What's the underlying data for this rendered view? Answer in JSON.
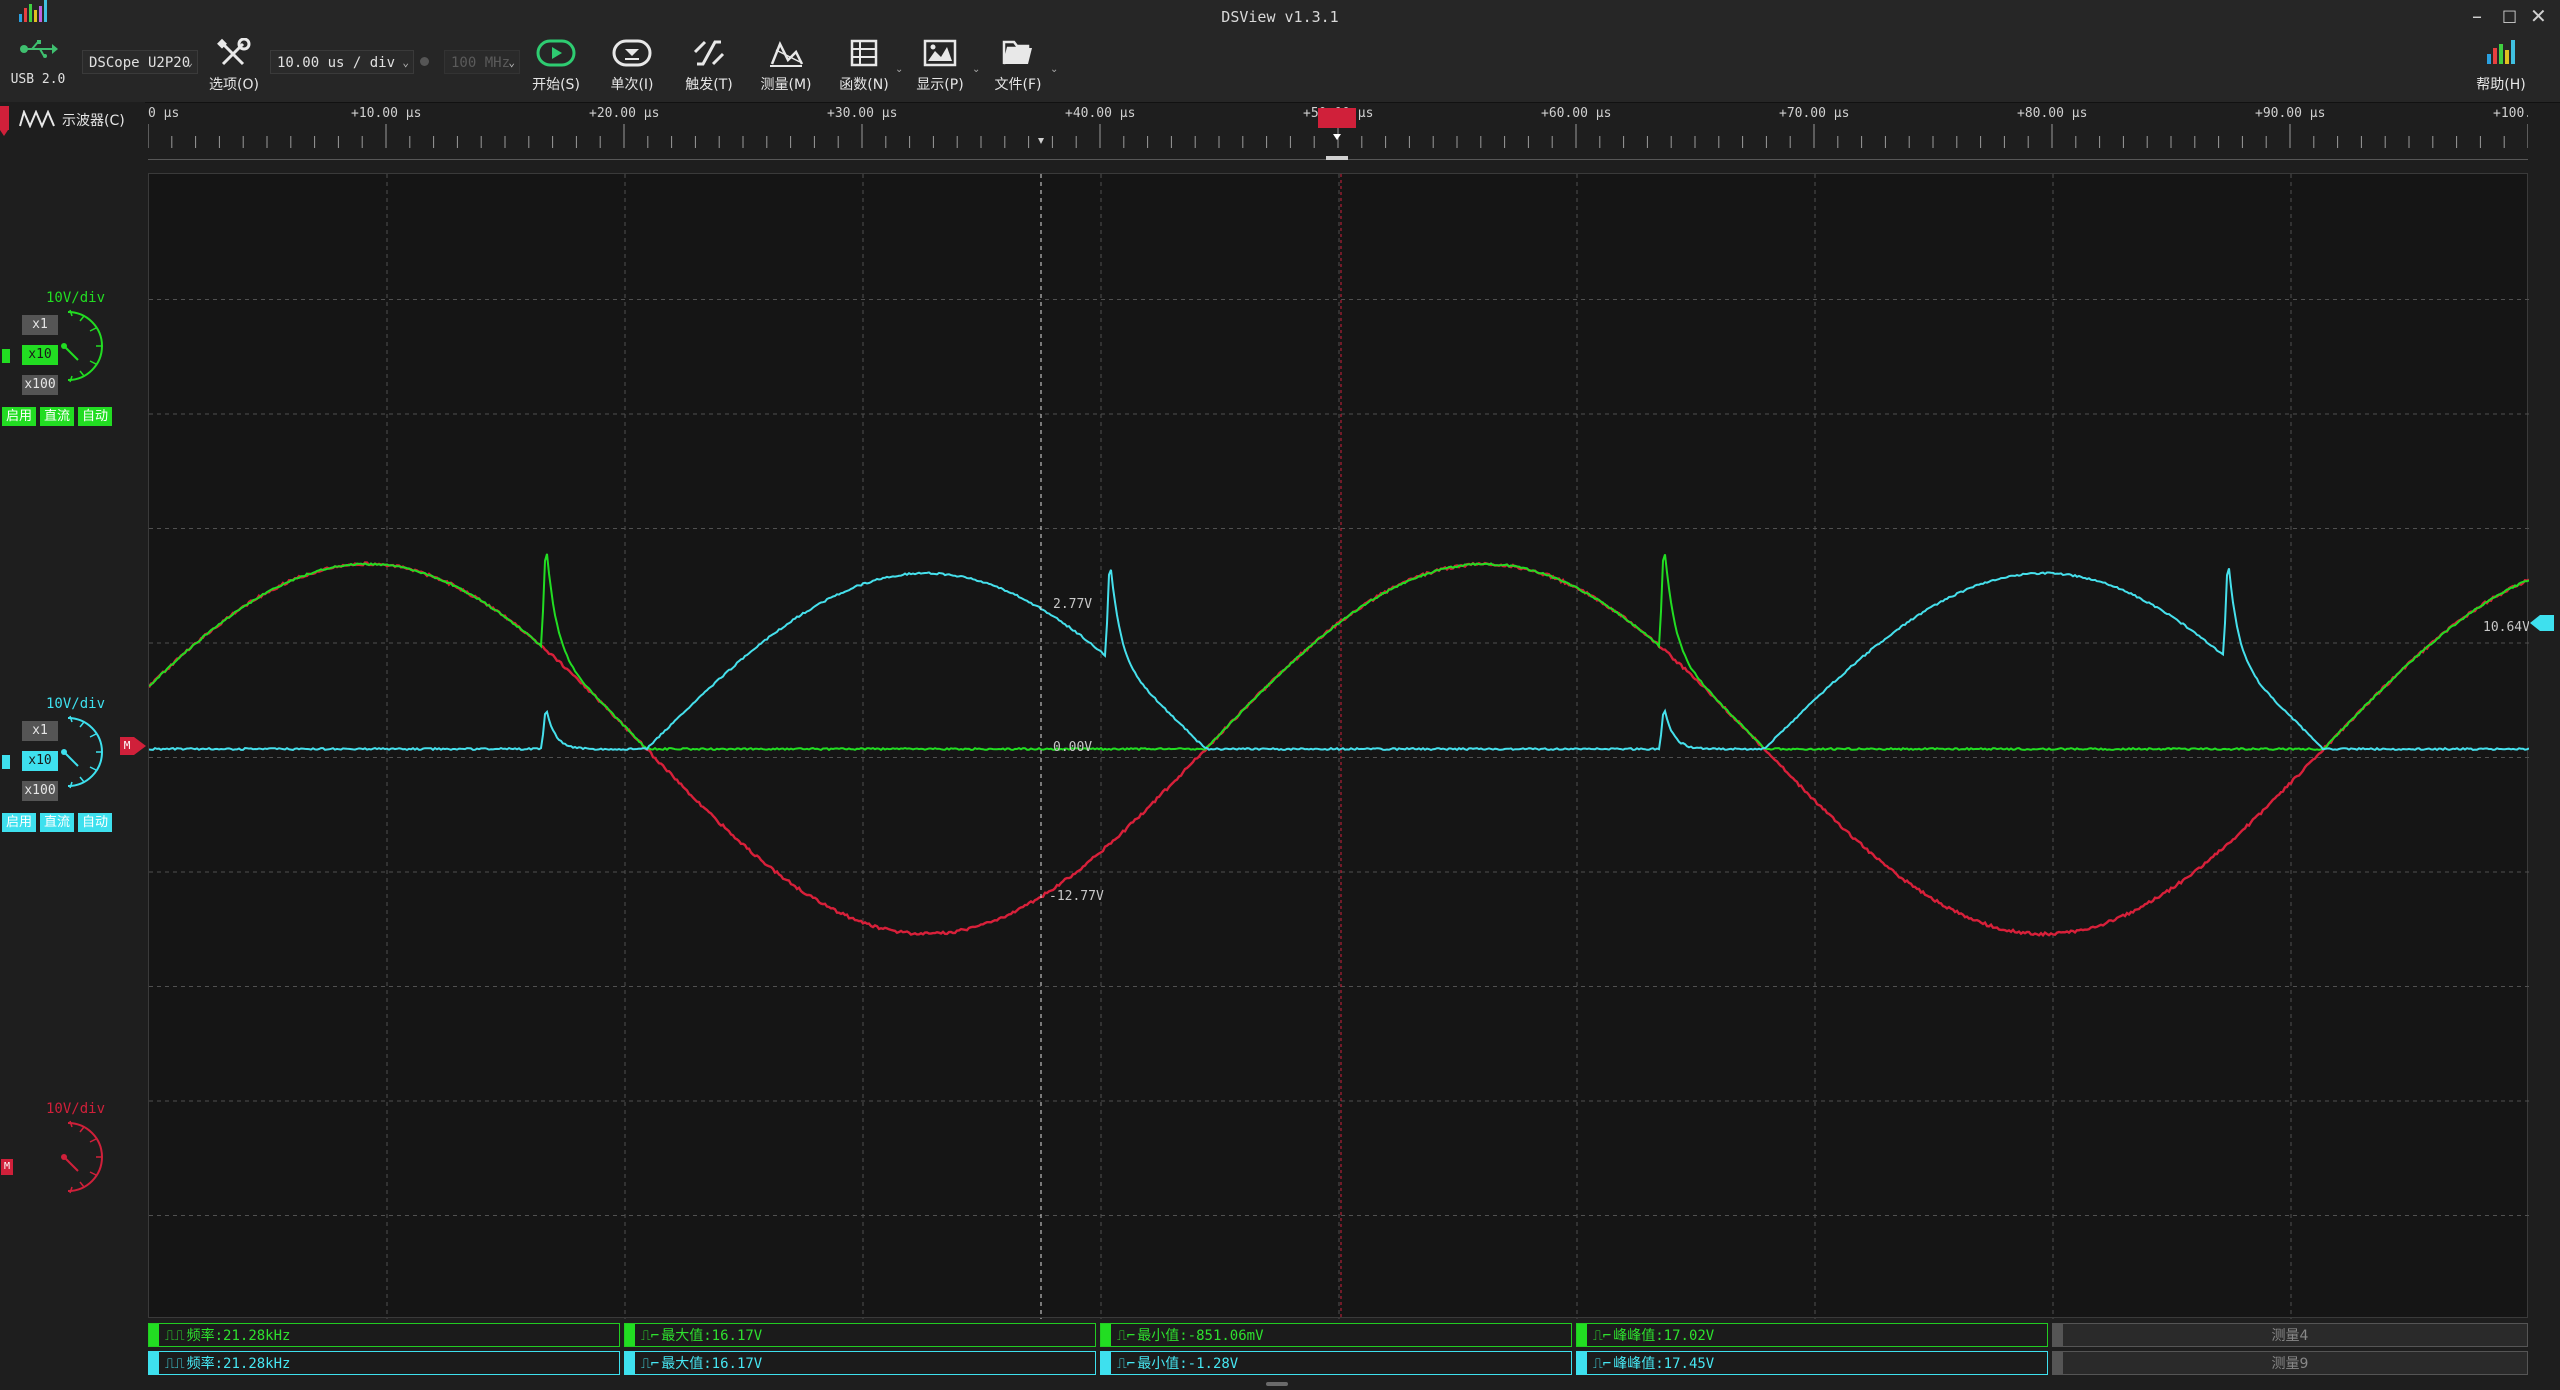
{
  "app": {
    "title": "DSView v1.3.1",
    "usb": "USB 2.0"
  },
  "toolbar": {
    "device": "DSCope U2P20",
    "timebase": "10.00 us / div",
    "bandwidth": "100 MHz",
    "buttons": [
      {
        "label": "选项(O)",
        "icon": "wrench-screwdriver-icon"
      },
      {
        "label": "开始(S)",
        "icon": "play-icon"
      },
      {
        "label": "单次(I)",
        "icon": "single-shot-icon"
      },
      {
        "label": "触发(T)",
        "icon": "trigger-icon"
      },
      {
        "label": "测量(M)",
        "icon": "measure-icon"
      },
      {
        "label": "函数(N)",
        "icon": "function-icon"
      },
      {
        "label": "显示(P)",
        "icon": "display-icon"
      },
      {
        "label": "文件(F)",
        "icon": "folder-icon"
      }
    ],
    "help": "帮助(H)"
  },
  "mode": {
    "label": "示波器(C)"
  },
  "channels": [
    {
      "id": "ch0",
      "color": "#22dd22",
      "vdiv": "10V/div",
      "scales": [
        "x1",
        "x10",
        "x100"
      ],
      "selected_scale": "x10",
      "buttons": [
        "启用",
        "直流",
        "自动"
      ]
    },
    {
      "id": "ch1",
      "color": "#3ee0ee",
      "vdiv": "10V/div",
      "scales": [
        "x1",
        "x10",
        "x100"
      ],
      "selected_scale": "x10",
      "buttons": [
        "启用",
        "直流",
        "自动"
      ]
    },
    {
      "id": "math",
      "color": "#d0203a",
      "vdiv": "10V/div",
      "marker": "M"
    }
  ],
  "ruler": {
    "labels": [
      "0 μs",
      "+10.00 μs",
      "+20.00 μs",
      "+30.00 μs",
      "+40.00 μs",
      "+50.00 μs",
      "+60.00 μs",
      "+70.00 μs",
      "+80.00 μs",
      "+90.00 μs",
      "+100."
    ]
  },
  "plot": {
    "cursor_labels": [
      "2.77V",
      "0.00V",
      "-12.77V"
    ],
    "right_marker": "10.64V",
    "math_marker": "M",
    "colors": {
      "ch0": "#22dd22",
      "ch1": "#46e0ec",
      "math": "#d8203a",
      "trigger": "#d0203a",
      "grid": "#505050"
    }
  },
  "measurements": {
    "row0": [
      "频率:21.28kHz",
      "最大值:16.17V",
      "最小值:-851.06mV",
      "峰峰值:17.02V",
      "测量4"
    ],
    "row1": [
      "频率:21.28kHz",
      "最大值:16.17V",
      "最小值:-1.28V",
      "峰峰值:17.45V",
      "测量9"
    ]
  }
}
